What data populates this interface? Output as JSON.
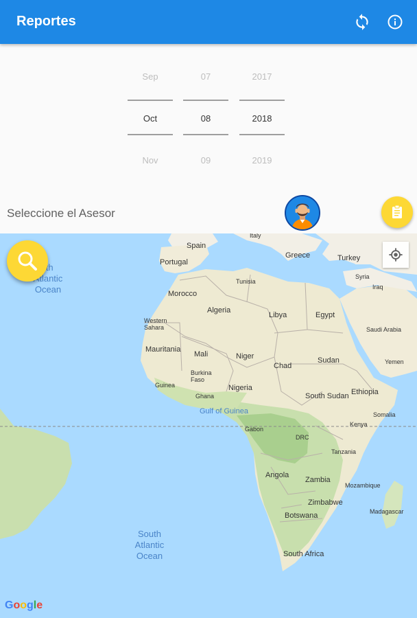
{
  "app": {
    "title": "Reportes"
  },
  "toolbar": {
    "refresh_icon": "refresh-icon",
    "info_icon": "info-icon"
  },
  "date_picker": {
    "month": {
      "prev": "Sep",
      "current": "Oct",
      "next": "Nov"
    },
    "day": {
      "prev": "07",
      "current": "08",
      "next": "09"
    },
    "year": {
      "prev": "2017",
      "current": "2018",
      "next": "2019"
    }
  },
  "asesor": {
    "label": "Seleccione el Asesor",
    "avatar_icon": "avatar-icon",
    "report_icon": "clipboard-icon"
  },
  "map": {
    "search_icon": "search-icon",
    "location_icon": "my-location-icon",
    "attribution": "Google",
    "labels": {
      "spain": "Spain",
      "italy": "Italy",
      "portugal": "Portugal",
      "greece": "Greece",
      "turkey": "Turkey",
      "tunisia": "Tunisia",
      "morocco": "Morocco",
      "syria": "Syria",
      "iraq": "Iraq",
      "algeria": "Algeria",
      "libya": "Libya",
      "egypt": "Egypt",
      "western_sahara": "Western Sahara",
      "saudi_arabia": "Saudi Arabia",
      "mauritania": "Mauritania",
      "mali": "Mali",
      "niger": "Niger",
      "chad": "Chad",
      "sudan": "Sudan",
      "yemen": "Yemen",
      "burkina_faso": "Burkina Faso",
      "guinea": "Guinea",
      "ghana": "Ghana",
      "nigeria": "Nigeria",
      "south_sudan": "South Sudan",
      "ethiopia": "Ethiopia",
      "somalia": "Somalia",
      "gulf_of_guinea": "Gulf of Guinea",
      "gabon": "Gabon",
      "kenya": "Kenya",
      "drc": "DRC",
      "tanzania": "Tanzania",
      "angola": "Angola",
      "zambia": "Zambia",
      "mozambique": "Mozambique",
      "zimbabwe": "Zimbabwe",
      "madagascar": "Madagascar",
      "botswana": "Botswana",
      "south_africa": "South Africa",
      "north_atlantic": "rth Atlantic Ocean",
      "south_atlantic": "South Atlantic Ocean"
    }
  },
  "colors": {
    "primary": "#1e88e5",
    "accent": "#fdd835",
    "water": "#aadaff",
    "land": "#f3efe3"
  }
}
